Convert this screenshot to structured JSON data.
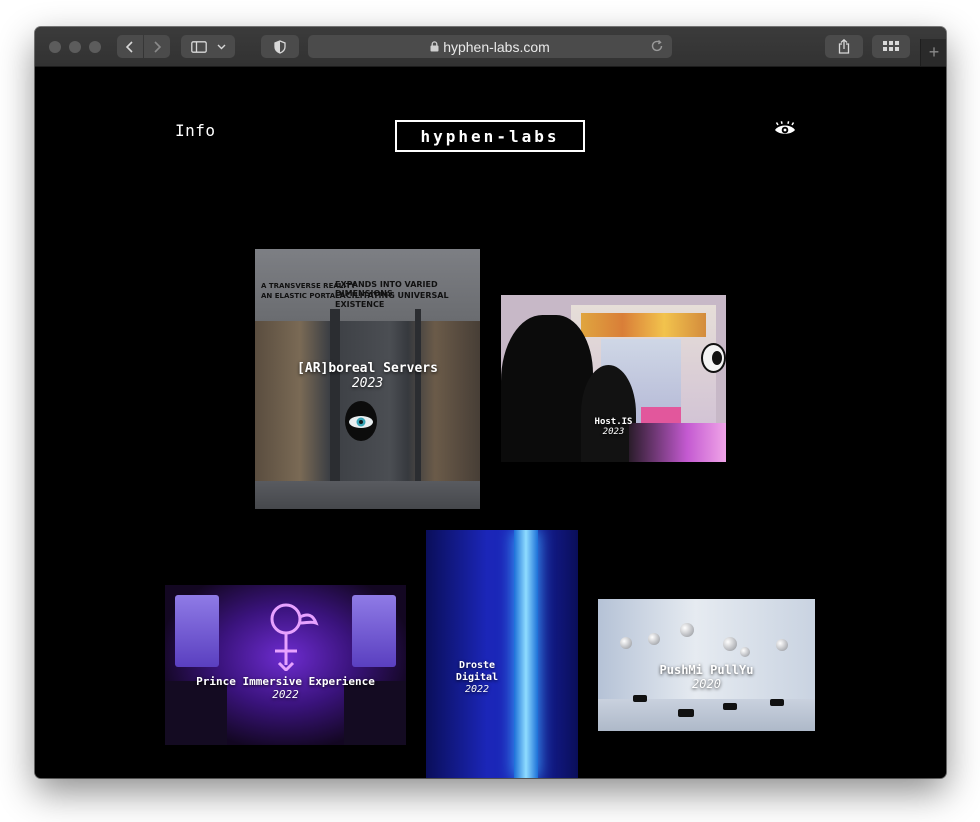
{
  "browser": {
    "url": "hyphen-labs.com",
    "new_tab_label": "+"
  },
  "site": {
    "nav_info": "Info",
    "logo": "hyphen-labs"
  },
  "projects": [
    {
      "title": "[AR]boreal Servers",
      "year": "2023",
      "facade_line1": "A TRANSVERSE REALITY",
      "facade_line2": "AN ELASTIC PORTAL",
      "facade_line3": "EXPANDS INTO VARIED DIMENSIONS",
      "facade_line4": "FACILITATING UNIVERSAL EXISTENCE"
    },
    {
      "title": "Host.IS",
      "year": "2023"
    },
    {
      "title": "Prince Immersive Experience",
      "year": "2022"
    },
    {
      "title": "Droste Digital",
      "year": "2022"
    },
    {
      "title": "PushMi PullYu",
      "year": "2020"
    }
  ]
}
